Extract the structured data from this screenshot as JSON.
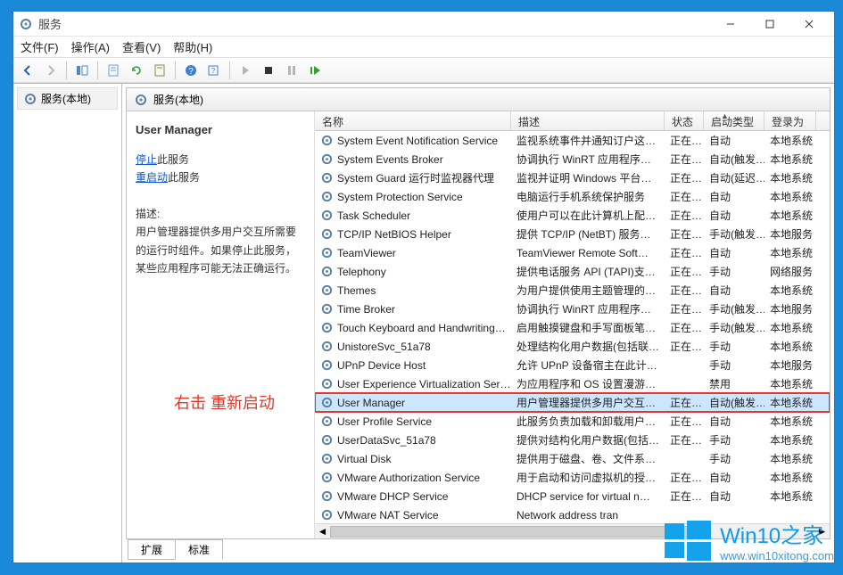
{
  "window": {
    "title": "服务"
  },
  "menu": {
    "file": "文件(F)",
    "action": "操作(A)",
    "view": "查看(V)",
    "help": "帮助(H)"
  },
  "left": {
    "node": "服务(本地)"
  },
  "header": {
    "title": "服务(本地)"
  },
  "detail": {
    "name": "User Manager",
    "stop_prefix": "停止",
    "stop_suffix": "此服务",
    "restart_prefix": "重启动",
    "restart_suffix": "此服务",
    "desc_label": "描述:",
    "desc_text": "用户管理器提供多用户交互所需要的运行时组件。如果停止此服务，某些应用程序可能无法正确运行。"
  },
  "annotation": "右击 重新启动",
  "columns": {
    "name": "名称",
    "desc": "描述",
    "state": "状态",
    "start": "启动类型",
    "logon": "登录为"
  },
  "rows": [
    {
      "name": "System Event Notification Service",
      "desc": "监视系统事件并通知订户这…",
      "state": "正在…",
      "start": "自动",
      "logon": "本地系统"
    },
    {
      "name": "System Events Broker",
      "desc": "协调执行 WinRT 应用程序…",
      "state": "正在…",
      "start": "自动(触发…",
      "logon": "本地系统"
    },
    {
      "name": "System Guard 运行时监视器代理",
      "desc": "监视并证明 Windows 平台…",
      "state": "正在…",
      "start": "自动(延迟…",
      "logon": "本地系统"
    },
    {
      "name": "System Protection Service",
      "desc": "电脑运行手机系统保护服务",
      "state": "正在…",
      "start": "自动",
      "logon": "本地系统"
    },
    {
      "name": "Task Scheduler",
      "desc": "使用户可以在此计算机上配…",
      "state": "正在…",
      "start": "自动",
      "logon": "本地系统"
    },
    {
      "name": "TCP/IP NetBIOS Helper",
      "desc": "提供 TCP/IP (NetBT) 服务…",
      "state": "正在…",
      "start": "手动(触发…",
      "logon": "本地服务"
    },
    {
      "name": "TeamViewer",
      "desc": "TeamViewer Remote Soft…",
      "state": "正在…",
      "start": "自动",
      "logon": "本地系统"
    },
    {
      "name": "Telephony",
      "desc": "提供电话服务 API (TAPI)支…",
      "state": "正在…",
      "start": "手动",
      "logon": "网络服务"
    },
    {
      "name": "Themes",
      "desc": "为用户提供使用主题管理的…",
      "state": "正在…",
      "start": "自动",
      "logon": "本地系统"
    },
    {
      "name": "Time Broker",
      "desc": "协调执行 WinRT 应用程序…",
      "state": "正在…",
      "start": "手动(触发…",
      "logon": "本地服务"
    },
    {
      "name": "Touch Keyboard and Handwriting…",
      "desc": "启用触摸键盘和手写面板笔…",
      "state": "正在…",
      "start": "手动(触发…",
      "logon": "本地系统"
    },
    {
      "name": "UnistoreSvc_51a78",
      "desc": "处理结构化用户数据(包括联…",
      "state": "正在…",
      "start": "手动",
      "logon": "本地系统"
    },
    {
      "name": "UPnP Device Host",
      "desc": "允许 UPnP 设备宿主在此计…",
      "state": "",
      "start": "手动",
      "logon": "本地服务"
    },
    {
      "name": "User Experience Virtualization Ser…",
      "desc": "为应用程序和 OS 设置漫游…",
      "state": "",
      "start": "禁用",
      "logon": "本地系统"
    },
    {
      "name": "User Manager",
      "desc": "用户管理器提供多用户交互…",
      "state": "正在…",
      "start": "自动(触发…",
      "logon": "本地系统",
      "selected": true,
      "highlight": true
    },
    {
      "name": "User Profile Service",
      "desc": "此服务负责加载和卸载用户…",
      "state": "正在…",
      "start": "自动",
      "logon": "本地系统"
    },
    {
      "name": "UserDataSvc_51a78",
      "desc": "提供对结构化用户数据(包括…",
      "state": "正在…",
      "start": "手动",
      "logon": "本地系统"
    },
    {
      "name": "Virtual Disk",
      "desc": "提供用于磁盘、卷、文件系…",
      "state": "",
      "start": "手动",
      "logon": "本地系统"
    },
    {
      "name": "VMware Authorization Service",
      "desc": "用于启动和访问虚拟机的授…",
      "state": "正在…",
      "start": "自动",
      "logon": "本地系统"
    },
    {
      "name": "VMware DHCP Service",
      "desc": "DHCP service for virtual n…",
      "state": "正在…",
      "start": "自动",
      "logon": "本地系统"
    },
    {
      "name": "VMware NAT Service",
      "desc": "Network address tran",
      "state": "",
      "start": "",
      "logon": ""
    }
  ],
  "tabs": {
    "extended": "扩展",
    "standard": "标准"
  },
  "watermark": {
    "big": "Win10之家",
    "small": "www.win10xitong.com"
  }
}
